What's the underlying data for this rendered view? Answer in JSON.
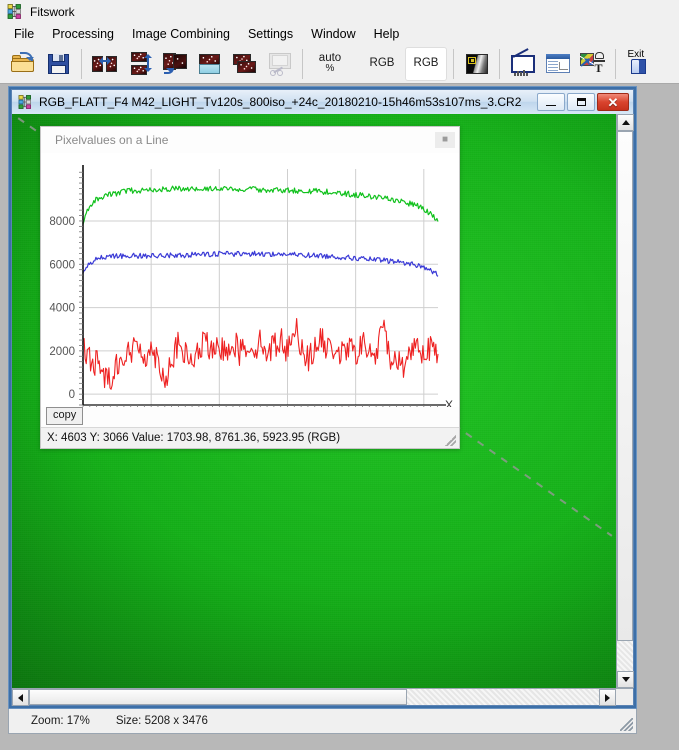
{
  "app": {
    "title": "Fitswork",
    "icon": "fitswork-app-icon"
  },
  "menu": {
    "items": [
      {
        "label": "File"
      },
      {
        "label": "Processing"
      },
      {
        "label": "Image Combining"
      },
      {
        "label": "Settings"
      },
      {
        "label": "Window"
      },
      {
        "label": "Help"
      }
    ]
  },
  "toolbar": {
    "buttons": [
      {
        "name": "open-file-button",
        "icon": "open-folder-icon",
        "type": "icon",
        "pressed": false
      },
      {
        "name": "save-file-button",
        "icon": "floppy-save-icon",
        "type": "icon",
        "pressed": false
      },
      {
        "name": "mirror-horizontal-button",
        "icon": "mirror-horizontal-icon",
        "type": "icon",
        "pressed": false
      },
      {
        "name": "mirror-vertical-button",
        "icon": "mirror-vertical-icon",
        "type": "icon",
        "pressed": false
      },
      {
        "name": "rotate-image-button",
        "icon": "rotate-image-icon",
        "type": "icon",
        "pressed": false
      },
      {
        "name": "flatten-background-button",
        "icon": "flatten-image-icon",
        "type": "icon",
        "pressed": false
      },
      {
        "name": "stack-images-button",
        "icon": "stack-images-icon",
        "type": "icon",
        "pressed": false
      },
      {
        "name": "crop-image-button",
        "icon": "crop-scissors-icon",
        "type": "icon",
        "pressed": false,
        "disabled": true
      },
      {
        "name": "auto-percent-button",
        "icon": "auto-percent-icon",
        "type": "text",
        "label": "auto",
        "sublabel": "%",
        "pressed": false
      },
      {
        "name": "rgb-split-button",
        "icon": "rgb-text-icon",
        "type": "text",
        "label": "RGB",
        "pressed": false
      },
      {
        "name": "rgb-combine-button",
        "icon": "rgb-text-icon",
        "type": "text",
        "label": "RGB",
        "pressed": true
      },
      {
        "name": "grayscale-preview-button",
        "icon": "grayscale-strip-icon",
        "type": "icon",
        "pressed": false
      },
      {
        "name": "histogram-button",
        "icon": "histogram-icon",
        "type": "icon",
        "pressed": false
      },
      {
        "name": "fits-header-button",
        "icon": "document-plot-icon",
        "type": "icon",
        "pressed": false
      },
      {
        "name": "annotate-button",
        "icon": "annotate-color-icon",
        "type": "icon",
        "pressed": false
      },
      {
        "name": "exit-button",
        "icon": "exit-door-icon",
        "type": "text",
        "label": "Exit",
        "pressed": false
      }
    ]
  },
  "child_window": {
    "icon": "fitswork-document-icon",
    "title": "RGB_FLATT_F4 M42_LIGHT_Tv120s_800iso_+24c_20180210-15h46m53s107ms_3.CR2",
    "controls": {
      "minimize": "minimize-button",
      "maximize": "maximize-button",
      "close": "close-button"
    },
    "image_color": "#13ad17",
    "measure_line_color": "#8f9a8f"
  },
  "plot_window": {
    "title": "Pixelvalues on a Line",
    "close_label": "■",
    "copy_label": "copy",
    "status": "X: 4603  Y: 3066  Value: 1703.98, 8761.36, 5923.95 (RGB)"
  },
  "main_status": {
    "zoom": "Zoom: 17%",
    "size": "Size: 5208 x 3476"
  },
  "chart_data": {
    "type": "line",
    "title": "Pixelvalues on a Line",
    "xlabel": "X",
    "ylabel": "",
    "xlim": [
      0,
      5208
    ],
    "ylim": [
      -500,
      10400
    ],
    "xticks": [
      1000,
      2000,
      3000,
      4000,
      5000
    ],
    "yticks": [
      0,
      2000,
      4000,
      6000,
      8000
    ],
    "grid": true,
    "legend": "none",
    "axis_marker_label": "X",
    "series": [
      {
        "name": "Green",
        "color": "#11c11d",
        "x": [
          0,
          100,
          200,
          300,
          400,
          500,
          600,
          700,
          800,
          900,
          1000,
          1100,
          1200,
          1300,
          1400,
          1500,
          1600,
          1700,
          1800,
          1900,
          2000,
          2100,
          2200,
          2300,
          2400,
          2500,
          2600,
          2700,
          2800,
          2900,
          3000,
          3100,
          3200,
          3300,
          3400,
          3500,
          3600,
          3700,
          3800,
          3900,
          4000,
          4100,
          4200,
          4300,
          4400,
          4500,
          4600,
          4700,
          4800,
          4900,
          5000,
          5100,
          5208
        ],
        "values": [
          7950,
          8720,
          9010,
          9150,
          9230,
          9280,
          9360,
          9410,
          9400,
          9430,
          9460,
          9450,
          9470,
          9480,
          9510,
          9480,
          9500,
          9520,
          9490,
          9470,
          9500,
          9480,
          9460,
          9470,
          9450,
          9470,
          9440,
          9430,
          9450,
          9420,
          9430,
          9410,
          9400,
          9380,
          9390,
          9350,
          9340,
          9300,
          9280,
          9250,
          9210,
          9180,
          9150,
          9100,
          9060,
          9010,
          8960,
          8880,
          8800,
          8700,
          8560,
          8300,
          7980
        ]
      },
      {
        "name": "Blue",
        "color": "#3a3ad6",
        "x": [
          0,
          100,
          200,
          300,
          400,
          500,
          600,
          700,
          800,
          900,
          1000,
          1100,
          1200,
          1300,
          1400,
          1500,
          1600,
          1700,
          1800,
          1900,
          2000,
          2100,
          2200,
          2300,
          2400,
          2500,
          2600,
          2700,
          2800,
          2900,
          3000,
          3100,
          3200,
          3300,
          3400,
          3500,
          3600,
          3700,
          3800,
          3900,
          4000,
          4100,
          4200,
          4300,
          4400,
          4500,
          4600,
          4700,
          4800,
          4900,
          5000,
          5100,
          5208
        ],
        "values": [
          5550,
          6050,
          6280,
          6330,
          6350,
          6370,
          6390,
          6400,
          6380,
          6400,
          6390,
          6410,
          6400,
          6420,
          6430,
          6410,
          6450,
          6470,
          6440,
          6450,
          6480,
          6490,
          6470,
          6500,
          6480,
          6490,
          6470,
          6480,
          6460,
          6470,
          6450,
          6440,
          6430,
          6420,
          6400,
          6390,
          6370,
          6350,
          6330,
          6300,
          6280,
          6250,
          6230,
          6200,
          6180,
          6150,
          6120,
          6080,
          6020,
          5960,
          5870,
          5720,
          5500
        ]
      },
      {
        "name": "Red",
        "color": "#ee2222",
        "x": [
          0,
          100,
          200,
          300,
          400,
          500,
          600,
          700,
          800,
          900,
          1000,
          1100,
          1200,
          1300,
          1400,
          1500,
          1600,
          1700,
          1800,
          1900,
          2000,
          2100,
          2200,
          2300,
          2400,
          2500,
          2600,
          2700,
          2800,
          2900,
          3000,
          3100,
          3200,
          3300,
          3400,
          3500,
          3600,
          3700,
          3800,
          3900,
          4000,
          4100,
          4200,
          4300,
          4400,
          4500,
          4600,
          4700,
          4800,
          4900,
          5000,
          5100,
          5208
        ],
        "values": [
          2100,
          1600,
          1450,
          900,
          700,
          1500,
          1700,
          1900,
          2300,
          1800,
          2000,
          1700,
          600,
          1600,
          2300,
          1800,
          1500,
          1900,
          2600,
          1700,
          2200,
          2000,
          2500,
          1900,
          2300,
          2100,
          2400,
          2000,
          2200,
          2600,
          1900,
          3250,
          2300,
          1600,
          2100,
          2500,
          2000,
          2200,
          1800,
          2100,
          1900,
          2300,
          2000,
          1700,
          3200,
          1800,
          1500,
          1300,
          2000,
          2400,
          1900,
          2200,
          1600
        ]
      }
    ]
  }
}
